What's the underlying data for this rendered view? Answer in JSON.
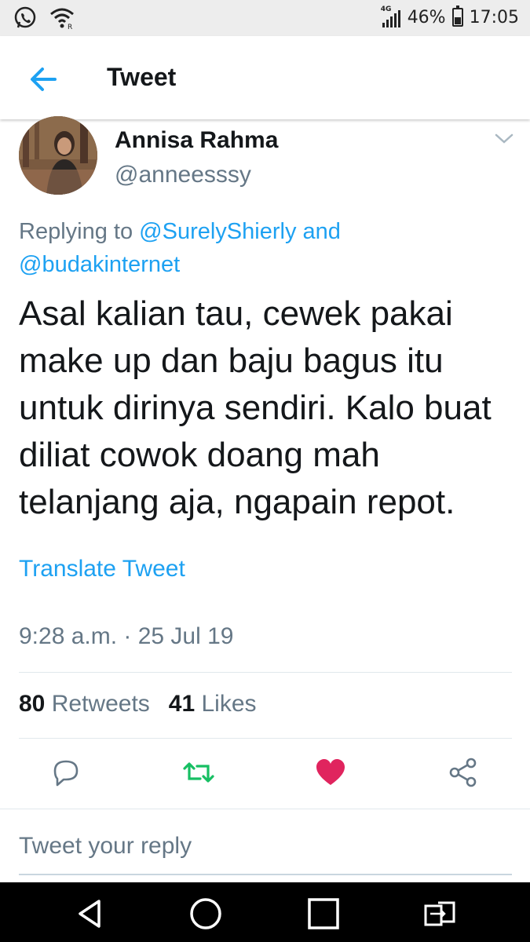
{
  "status_bar": {
    "network": "4G",
    "battery_text": "46%",
    "battery_level": 0.46,
    "time": "17:05",
    "notification_icons": [
      "whatsapp-icon",
      "wifi-icon"
    ]
  },
  "header": {
    "title": "Tweet",
    "back_icon": "back-arrow-icon"
  },
  "tweet": {
    "author_name": "Annisa Rahma",
    "author_handle": "@anneesssy",
    "reply_prefix": "Replying to",
    "reply_mention_1": "@SurelyShierly",
    "reply_and": "and",
    "reply_mention_2": "@budakinternet",
    "text": "Asal kalian tau, cewek pakai make up dan baju bagus itu untuk dirinya sendiri. Kalo buat diliat cowok doang mah telanjang aja, ngapain repot.",
    "translate_label": "Translate Tweet",
    "timestamp": "9:28 a.m. · 25 Jul 19",
    "retweet_count": "80",
    "retweet_label": "Retweets",
    "like_count": "41",
    "like_label": "Likes"
  },
  "actions": {
    "icons": [
      "reply-icon",
      "retweet-icon",
      "like-icon",
      "share-icon"
    ]
  },
  "reply_box": {
    "placeholder": "Tweet your reply"
  },
  "colors": {
    "accent": "#1da1f2",
    "retweet": "#17bf63",
    "like": "#e0245e",
    "secondary_text": "#657786"
  }
}
